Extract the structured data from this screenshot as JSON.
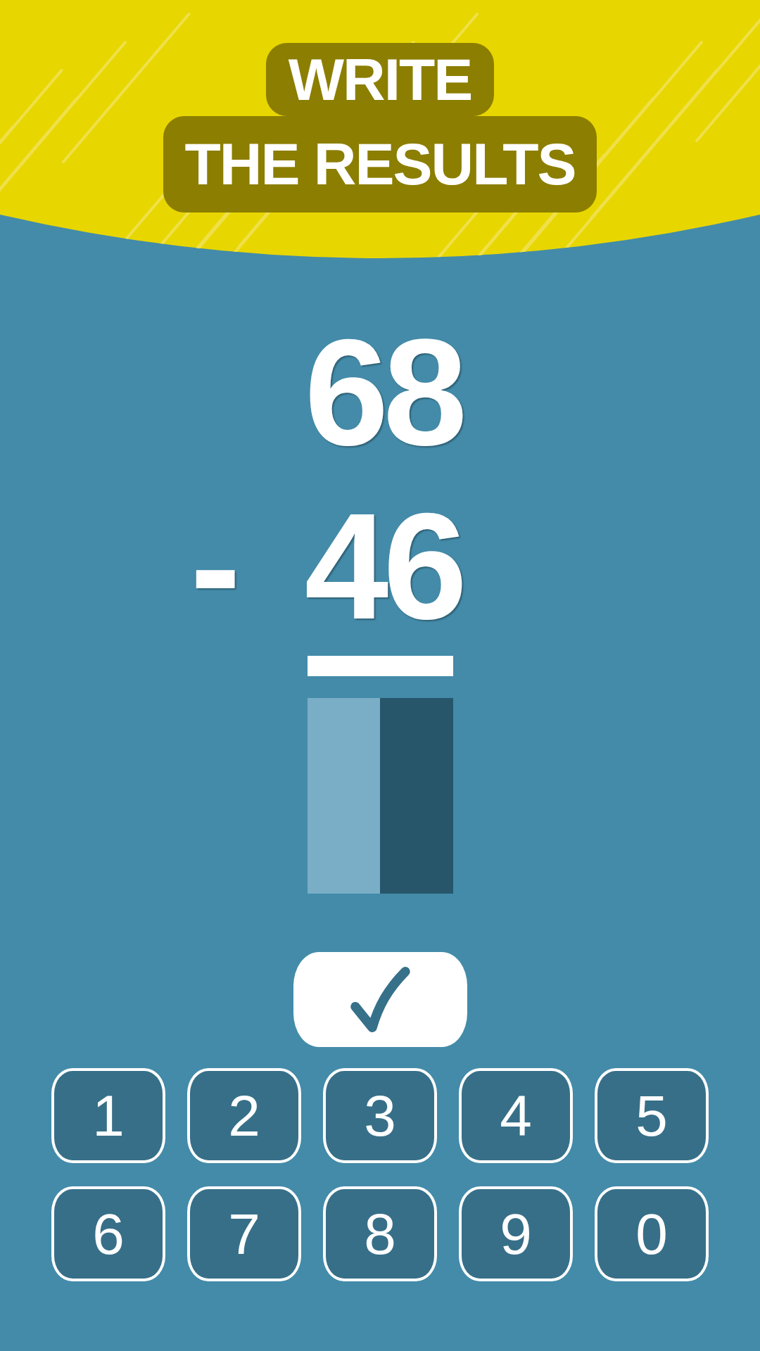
{
  "title": {
    "lines": [
      "WRITE",
      "THE RESULTS"
    ]
  },
  "problem": {
    "operands": [
      "68",
      "46"
    ],
    "operator": "-"
  },
  "answer": {
    "slots": [
      {
        "selected": false
      },
      {
        "selected": true
      }
    ]
  },
  "keypad": {
    "keys": [
      "1",
      "2",
      "3",
      "4",
      "5",
      "6",
      "7",
      "8",
      "9",
      "0"
    ]
  }
}
